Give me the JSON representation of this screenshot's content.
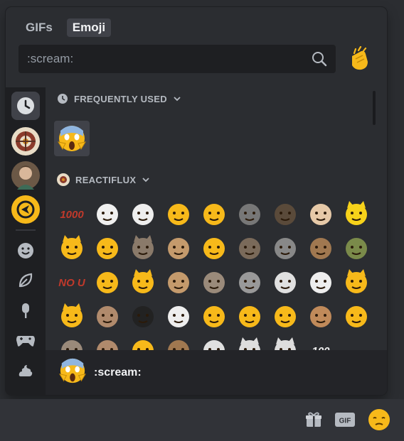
{
  "tabs": [
    {
      "label": "GIFs",
      "active": false
    },
    {
      "label": "Emoji",
      "active": true
    }
  ],
  "search": {
    "value": ":scream:"
  },
  "sections": {
    "frequent": {
      "title": "FREQUENTLY USED"
    },
    "server": {
      "title": "REACTIFLUX"
    }
  },
  "preview": {
    "label": ":scream:"
  },
  "colors": {
    "accent_yellow": "#f7b91a",
    "panel": "#2b2d31",
    "sidebar": "#1e1f22"
  },
  "bottom_bar": {
    "gif_label": "GIF"
  },
  "emoji_grid": [
    [
      "1000",
      "thumbsup",
      "rageface",
      "sideways-smile",
      "blob-smirk",
      "tesla",
      "bald-man",
      "hand-spray",
      "surprised-pikachu"
    ],
    [
      "pikachu-cat",
      "angry-cat",
      "cat-fedora",
      "man-thumbsup",
      "tiny-smile",
      "man-dance",
      "raccoon",
      "man-thinking",
      "frog"
    ],
    [
      "no-u",
      "no-blob",
      "cat-thinking",
      "man-face",
      "kappa",
      "haskell",
      "trollface",
      "dog",
      "cat-pointing"
    ],
    [
      "cat-pointing-2",
      "man-smirk",
      "black-cat",
      "blob-white",
      "blob-thinking",
      "bee-cheers",
      "blob-pray",
      "fedora-man",
      "blob-thinking-2"
    ],
    [
      "sloth",
      "man-face-2",
      "blob-grin",
      "man-face-3",
      "ghost",
      "cat-laptop",
      "cat-nosy",
      "100-stroke",
      ""
    ]
  ]
}
